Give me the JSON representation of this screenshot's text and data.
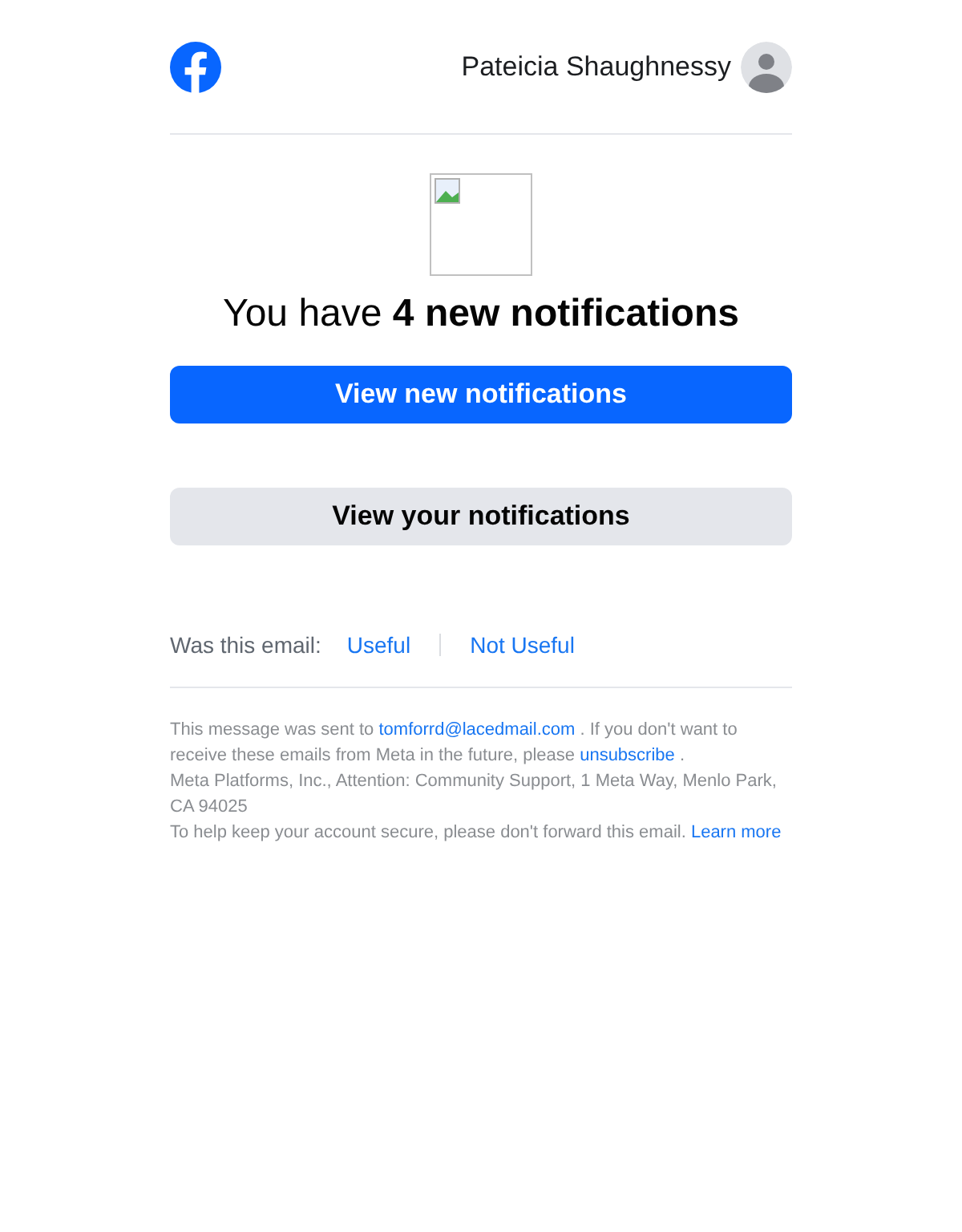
{
  "header": {
    "user_name": "Pateicia Shaughnessy"
  },
  "headline": "You have **4 new notifications**",
  "buttons": [
    {
      "label": "View new notifications",
      "kind": "primary"
    },
    {
      "label": "View your notifications",
      "kind": "secondary"
    }
  ],
  "feedback": {
    "prompt": "Was this email:",
    "options": [
      "Useful",
      "Not Useful"
    ]
  },
  "footer": {
    "sent_before": "This message was sent to",
    "email": "tomforrd@lacedmail.com",
    "sent_after": ". If you don't want to receive these emails from Meta in the future, please",
    "unsubscribe": "unsubscribe",
    "unsubscribe_after": ".",
    "address": "Meta Platforms, Inc., Attention: Community Support, 1 Meta Way, Menlo Park, CA 94025",
    "security": "To help keep your account secure, please don't forward this email.",
    "learn_more": "Learn more"
  }
}
